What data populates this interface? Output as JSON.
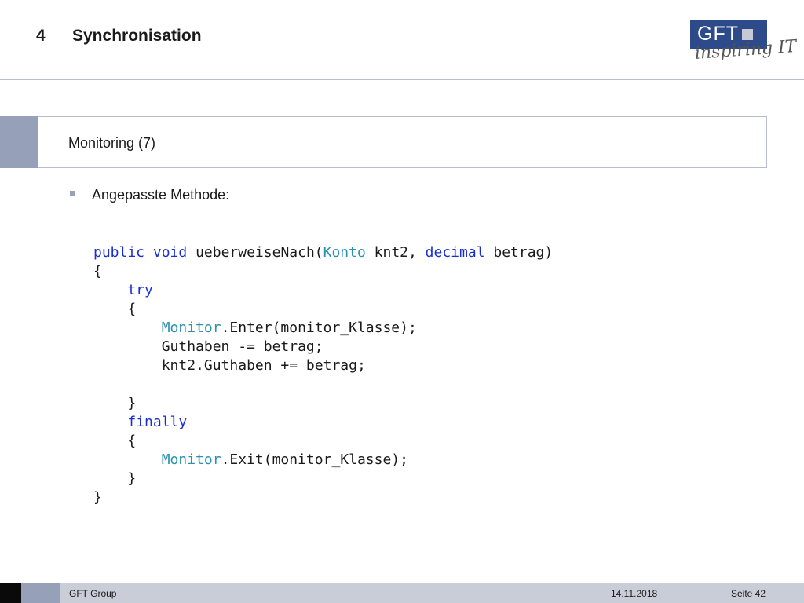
{
  "header": {
    "chapter_number": "4",
    "chapter_title": "Synchronisation",
    "logo_text": "GFT",
    "tagline": "inspiring IT"
  },
  "section": {
    "title": "Monitoring (7)"
  },
  "bullet": {
    "text": "Angepasste Methode:"
  },
  "code": {
    "line_1": {
      "kw1": "public",
      "kw2": "void",
      "rest_a": " ueberweiseNach(",
      "type": "Konto",
      "rest_b": " knt2, ",
      "kw3": "decimal",
      "rest_c": " betrag)"
    },
    "line_2": "{",
    "line_3": "try",
    "line_4": "{",
    "line_5": {
      "type": "Monitor",
      "rest": ".Enter(monitor_Klasse);"
    },
    "line_6": "Guthaben -= betrag;",
    "line_7": "knt2.Guthaben += betrag;",
    "line_9": "}",
    "line_10": "finally",
    "line_11": "{",
    "line_12": {
      "type": "Monitor",
      "rest": ".Exit(monitor_Klasse);"
    },
    "line_13": "}",
    "line_14": "}"
  },
  "footer": {
    "company": "GFT Group",
    "date": "14.11.2018",
    "page": "Seite 42"
  },
  "colors": {
    "keyword": "#1b2fd0",
    "type": "#2b91af",
    "accent": "#96a0b8",
    "logo": "#2d4a8a"
  }
}
